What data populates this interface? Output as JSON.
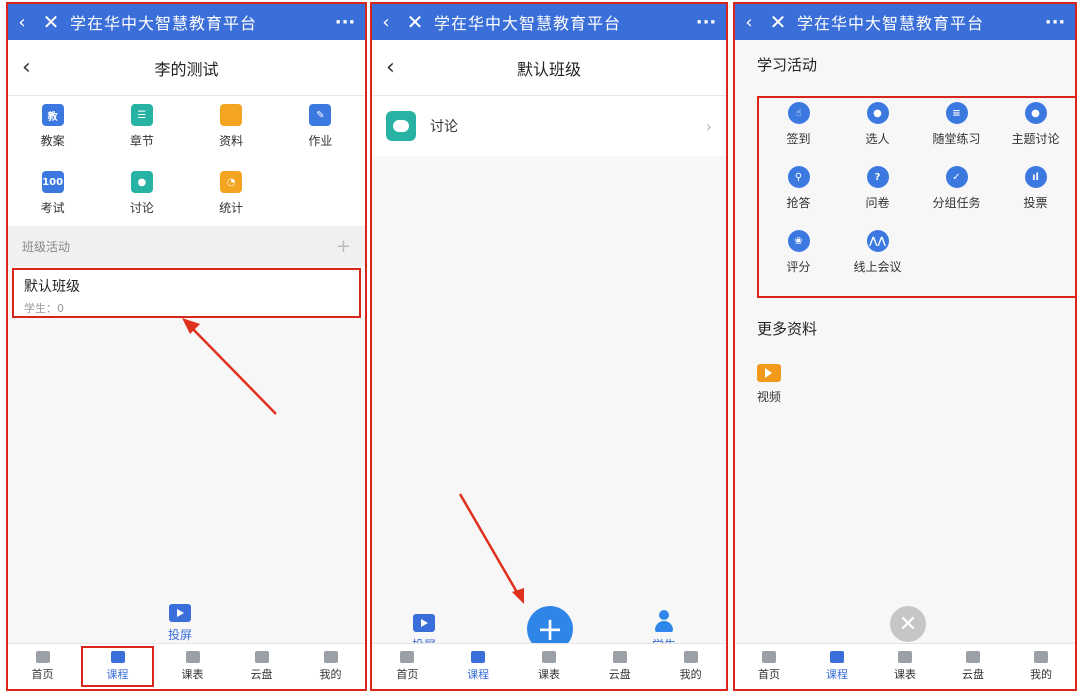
{
  "app": {
    "title": "学在华中大智慧教育平台",
    "close_icon": "close-icon",
    "more_icon": "more-icon"
  },
  "panel1": {
    "nav_title": "李的测试",
    "grid": [
      {
        "label": "教案",
        "icon": "lesson-plan-icon",
        "glyph": "教",
        "color": "#3b79e0"
      },
      {
        "label": "章节",
        "icon": "chapter-icon",
        "glyph": "☰",
        "color": "#27b3a3"
      },
      {
        "label": "资料",
        "icon": "folder-icon",
        "glyph": "",
        "color": "#f3a521"
      },
      {
        "label": "作业",
        "icon": "homework-icon",
        "glyph": "✎",
        "color": "#3b79e0"
      },
      {
        "label": "考试",
        "icon": "exam-icon",
        "glyph": "100",
        "color": "#3b79e0"
      },
      {
        "label": "讨论",
        "icon": "discussion-icon",
        "glyph": "●",
        "color": "#27b3a3"
      },
      {
        "label": "统计",
        "icon": "pie-chart-icon",
        "glyph": "◔",
        "color": "#f3a521"
      }
    ],
    "section_label": "班级活动",
    "add_icon": "plus-icon",
    "class_card": {
      "title": "默认班级",
      "subtitle": "学生：0"
    },
    "project_label": "投屏"
  },
  "panel2": {
    "nav_title": "默认班级",
    "item_label": "讨论",
    "project_label": "投屏",
    "student_label": "学生"
  },
  "panel3": {
    "section1": "学习活动",
    "activities": [
      {
        "label": "签到",
        "icon": "sign-in-icon",
        "glyph": "☝"
      },
      {
        "label": "选人",
        "icon": "pick-person-icon",
        "glyph": "●"
      },
      {
        "label": "随堂练习",
        "icon": "practice-icon",
        "glyph": "≡"
      },
      {
        "label": "主题讨论",
        "icon": "topic-discussion-icon",
        "glyph": "●"
      },
      {
        "label": "抢答",
        "icon": "quick-answer-icon",
        "glyph": "⚲"
      },
      {
        "label": "问卷",
        "icon": "questionnaire-icon",
        "glyph": "?"
      },
      {
        "label": "分组任务",
        "icon": "group-task-icon",
        "glyph": "✓"
      },
      {
        "label": "投票",
        "icon": "vote-icon",
        "glyph": "ıl"
      },
      {
        "label": "评分",
        "icon": "rating-icon",
        "glyph": "❀"
      },
      {
        "label": "线上会议",
        "icon": "online-meeting-icon",
        "glyph": "⋀⋀"
      }
    ],
    "section2": "更多资料",
    "video_label": "视频"
  },
  "tabs": [
    {
      "label": "首页",
      "icon": "home-icon"
    },
    {
      "label": "课程",
      "icon": "course-icon"
    },
    {
      "label": "课表",
      "icon": "schedule-icon"
    },
    {
      "label": "云盘",
      "icon": "cloud-icon"
    },
    {
      "label": "我的",
      "icon": "profile-icon"
    }
  ],
  "colors": {
    "primary": "#3a6ed8",
    "highlight_red": "#d9261c",
    "teal": "#27b3a3",
    "orange": "#f3a521"
  }
}
